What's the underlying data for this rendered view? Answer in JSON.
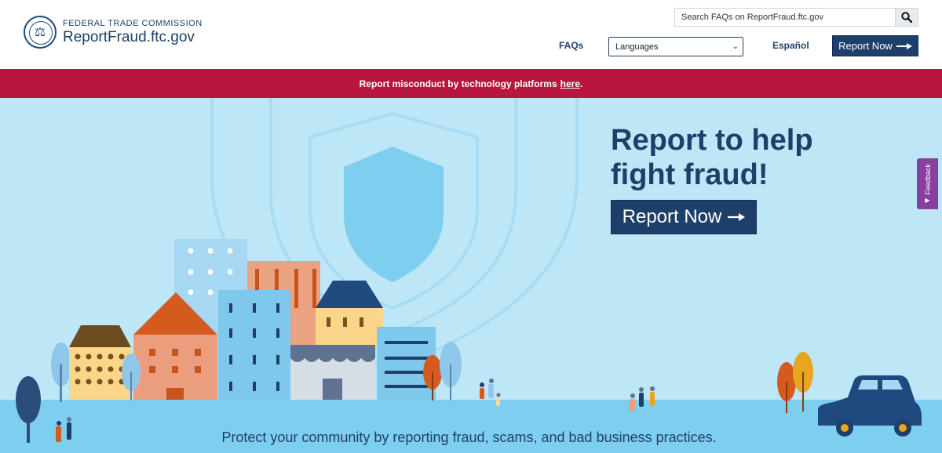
{
  "header": {
    "org_name": "FEDERAL TRADE COMMISSION",
    "site_name": "ReportFraud.ftc.gov",
    "search_placeholder": "Search FAQs on ReportFraud.ftc.gov",
    "nav": {
      "faqs": "FAQs",
      "languages_selected": "Languages",
      "espanol": "Español",
      "report_now": "Report Now"
    }
  },
  "banner": {
    "text": "Report misconduct by technology platforms",
    "link": "here",
    "suffix": "."
  },
  "hero": {
    "title": "Report to help fight fraud!",
    "button": "Report Now",
    "tagline": "Protect your community by reporting fraud, scams, and bad business practices."
  },
  "feedback": {
    "label": "Feedback"
  },
  "icons": {
    "search": "search-icon",
    "arrow": "arrow-right-icon",
    "seal": "ftc-seal-icon"
  },
  "colors": {
    "navy": "#1f3f6b",
    "banner_red": "#b8163e",
    "hero_bg": "#bde6f7",
    "feedback_purple": "#8a3ea0"
  }
}
